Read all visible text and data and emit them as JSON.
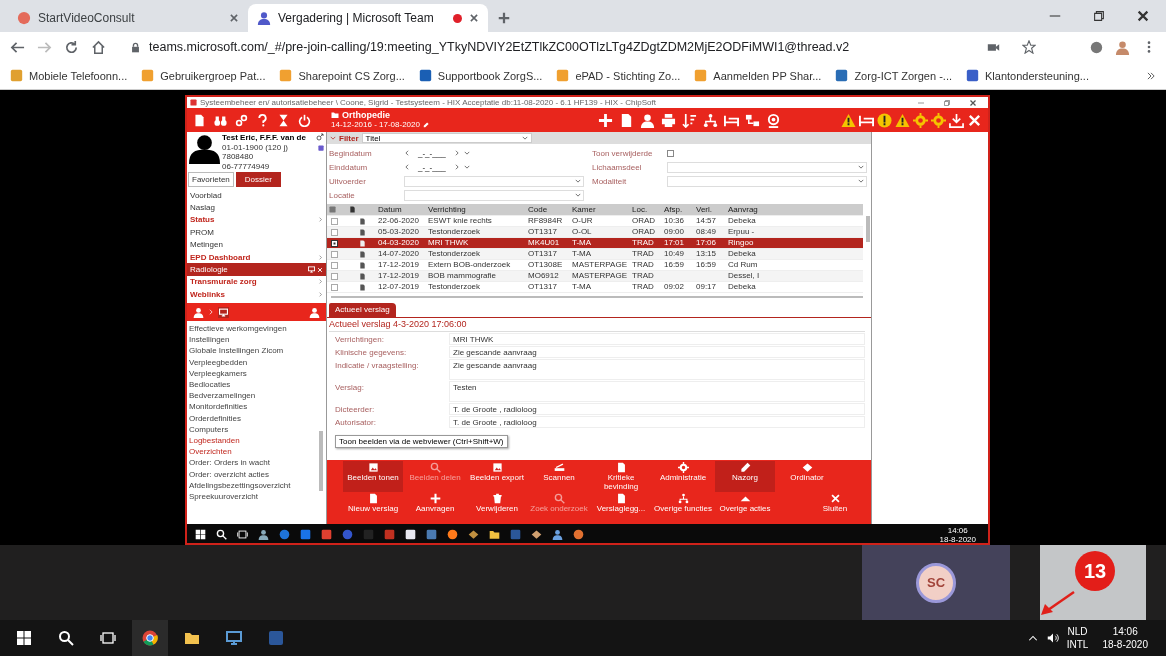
{
  "browser": {
    "tabs": [
      {
        "title": "StartVideoConsult",
        "selected": false,
        "recording": false
      },
      {
        "title": "Vergadering | Microsoft Team",
        "selected": true,
        "recording": true
      }
    ],
    "url": "teams.microsoft.com/_#/pre-join-calling/19:meeting_YTkyNDVIY2EtZTlkZC00OTlzLTg4ZDgtZDM2MjE2ODFiMWI1@thread.v2",
    "bookmarks": [
      {
        "label": "Mobiele Telefoonn...",
        "color": "#e0a030"
      },
      {
        "label": "Gebruikergroep Pat...",
        "color": "#f0a030"
      },
      {
        "label": "Sharepoint CS Zorg...",
        "color": "#f0a030"
      },
      {
        "label": "Supportbook ZorgS...",
        "color": "#1a5fb4"
      },
      {
        "label": "ePAD - Stichting Zo...",
        "color": "#f0a030"
      },
      {
        "label": "Aanmelden PP Shar...",
        "color": "#f0a030"
      },
      {
        "label": "Zorg-ICT Zorgen -...",
        "color": "#2a6db5"
      },
      {
        "label": "Klantondersteuning...",
        "color": "#3a5fc8"
      }
    ]
  },
  "shared_screen": {
    "title": "Systeembeheer en/ autorisatiebeheer \\ Coone, Sigrid - Testsysteem - HIX Acceptatie db:11-08-2020 - 6.1 HF139 - HIX - ChipSoft",
    "department": "Orthopedie",
    "period": "14-12-2016 - 17-08-2020",
    "patient": {
      "name": "Test Eric, F.F.F. van de",
      "birth": "01-01-1900 (120 j)",
      "number": "7808480",
      "phone": "06-77774949"
    },
    "panel_tabs": [
      {
        "label": "Favorieten",
        "selected": false
      },
      {
        "label": "Dossier",
        "selected": true
      }
    ],
    "menu": [
      {
        "label": "Voorblad",
        "kind": "item",
        "selected": false
      },
      {
        "label": "Naslag",
        "kind": "item",
        "selected": false
      },
      {
        "label": "Status",
        "kind": "group",
        "selected": false
      },
      {
        "label": "PROM",
        "kind": "item",
        "selected": false
      },
      {
        "label": "Metingen",
        "kind": "item",
        "selected": false
      },
      {
        "label": "EPD Dashboard",
        "kind": "group",
        "selected": false
      },
      {
        "label": "Radiologie",
        "kind": "item",
        "selected": true
      },
      {
        "label": "Transmurale zorg",
        "kind": "group",
        "selected": false
      },
      {
        "label": "Weblinks",
        "kind": "group",
        "selected": false
      }
    ],
    "admin_list": [
      {
        "label": "Effectieve werkomgevingen",
        "kind": "item"
      },
      {
        "label": "Instellingen",
        "kind": "item"
      },
      {
        "label": "Globale Instellingen Zicom",
        "kind": "item"
      },
      {
        "label": "Verpleegbedden",
        "kind": "item"
      },
      {
        "label": "Verpleegkamers",
        "kind": "item"
      },
      {
        "label": "Bedlocaties",
        "kind": "item"
      },
      {
        "label": "Bedverzamelingen",
        "kind": "item"
      },
      {
        "label": "Monitordefinities",
        "kind": "item"
      },
      {
        "label": "Orderdefinities",
        "kind": "item"
      },
      {
        "label": "Computers",
        "kind": "item"
      },
      {
        "label": "Logbestanden",
        "kind": "header"
      },
      {
        "label": "Overzichten",
        "kind": "header"
      },
      {
        "label": "Order: Orders in wacht",
        "kind": "item"
      },
      {
        "label": "Order: overzicht acties",
        "kind": "item"
      },
      {
        "label": "Afdelingsbezettingsoverzicht",
        "kind": "item"
      },
      {
        "label": "Spreekuuroverzicht",
        "kind": "item"
      }
    ],
    "filter": {
      "title": "Filter",
      "preset": "Titel",
      "fields": [
        {
          "label": "Begindatum",
          "kind": "date",
          "value": "_-_-___"
        },
        {
          "label": "Toon verwijderde",
          "kind": "checkbox",
          "checked": false
        },
        {
          "label": "Einddatum",
          "kind": "date",
          "value": "_-_-___"
        },
        {
          "label": "Lichaamsdeel",
          "kind": "select"
        },
        {
          "label": "Uitvoerder",
          "kind": "select"
        },
        {
          "label": "Modaliteit",
          "kind": "select"
        },
        {
          "label": "Locatie",
          "kind": "select"
        }
      ]
    },
    "table": {
      "columns": [
        "Datum",
        "Verrichting",
        "Code",
        "Kamer",
        "Loc.",
        "Afsp.",
        "Verl.",
        "Aanvrag"
      ],
      "rows": [
        {
          "checked": false,
          "selected": false,
          "cells": [
            "22-06-2020",
            "ESWT knie rechts",
            "RF8984R",
            "O-UR",
            "ORAD",
            "10:36",
            "14:57",
            "Debeka"
          ]
        },
        {
          "checked": false,
          "selected": false,
          "cells": [
            "05-03-2020",
            "Testonderzoek",
            "OT1317",
            "O-OL",
            "ORAD",
            "09:00",
            "08:49",
            "Erpuu -"
          ]
        },
        {
          "checked": true,
          "selected": true,
          "cells": [
            "04-03-2020",
            "MRI THWK",
            "MK4U01",
            "T-MA",
            "TRAD",
            "17:01",
            "17:06",
            "Ringoo"
          ]
        },
        {
          "checked": false,
          "selected": false,
          "cells": [
            "14-07-2020",
            "Testonderzoek",
            "OT1317",
            "T-MA",
            "TRAD",
            "10:49",
            "13:15",
            "Debeka"
          ]
        },
        {
          "checked": false,
          "selected": false,
          "cells": [
            "17-12-2019",
            "Extern BOB-onderzoek",
            "OT1308E",
            "MASTERPAGE",
            "TRAD",
            "16:59",
            "16:59",
            "Cd Rum"
          ]
        },
        {
          "checked": false,
          "selected": false,
          "cells": [
            "17-12-2019",
            "BOB mammografie",
            "MO6912",
            "MASTERPAGE",
            "TRAD",
            null,
            null,
            "Dessel, I"
          ]
        },
        {
          "checked": false,
          "selected": false,
          "cells": [
            "12-07-2019",
            "Testonderzoek",
            "OT1317",
            "T-MA",
            "TRAD",
            "09:02",
            "09:17",
            "Debeka"
          ]
        }
      ]
    },
    "report": {
      "tab": "Actueel verslag",
      "heading": "Actueel verslag 4-3-2020 17:06:00",
      "fields": [
        {
          "label": "Verrichtingen:",
          "value": "MRI THWK",
          "kind": "single"
        },
        {
          "label": "Klinische gegevens:",
          "value": "Zie gescande aanvraag",
          "kind": "single"
        },
        {
          "label": "Indicatie / vraagstelling:",
          "value": "Zie gescande aanvraag",
          "kind": "multiline"
        },
        {
          "label": "Verslag:",
          "value": "Testen",
          "kind": "multiline"
        },
        {
          "label": "Dicteerder:",
          "value": "T. de Groote , radioloog",
          "kind": "single"
        },
        {
          "label": "Autorisator:",
          "value": "T. de Groote , radioloog",
          "kind": "single"
        }
      ],
      "tooltip": "Toon beelden via de webviewer (Ctrl+Shift+W)"
    },
    "actions": [
      [
        {
          "label": "Beelden tonen",
          "selected": true,
          "disabled": false
        },
        {
          "label": "Beelden delen",
          "selected": false,
          "disabled": true
        },
        {
          "label": "Beelden export",
          "selected": false,
          "disabled": false
        },
        {
          "label": "Scannen",
          "selected": false,
          "disabled": false
        },
        {
          "label": "Kritieke bevinding",
          "selected": false,
          "disabled": false
        },
        {
          "label": "Administratie",
          "selected": false,
          "disabled": false
        },
        {
          "label": "Nazorg",
          "selected": true,
          "disabled": false
        },
        {
          "label": "Ordinator",
          "selected": false,
          "disabled": false
        }
      ],
      [
        {
          "label": "Nieuw verslag",
          "selected": false,
          "disabled": false
        },
        {
          "label": "Aanvragen",
          "selected": false,
          "disabled": false
        },
        {
          "label": "Verwijderen",
          "selected": false,
          "disabled": false
        },
        {
          "label": "Zoek onderzoek",
          "selected": false,
          "disabled": true
        },
        {
          "label": "Verslaglegg...",
          "selected": false,
          "disabled": false
        },
        {
          "label": "Overige functies",
          "selected": false,
          "disabled": false
        },
        {
          "label": "Overige acties",
          "selected": false,
          "disabled": false
        },
        {
          "label": "Sluiten",
          "selected": false,
          "disabled": false
        }
      ]
    ],
    "taskbar": {
      "time": "14:06",
      "date": "18-8-2020"
    }
  },
  "participants": [
    {
      "kind": "avatar",
      "initials": "SC"
    },
    {
      "kind": "video"
    }
  ],
  "annotation": {
    "number": "13"
  },
  "taskbar": {
    "language": "NLD",
    "layout": "INTL",
    "time": "14:06",
    "date": "18-8-2020"
  }
}
